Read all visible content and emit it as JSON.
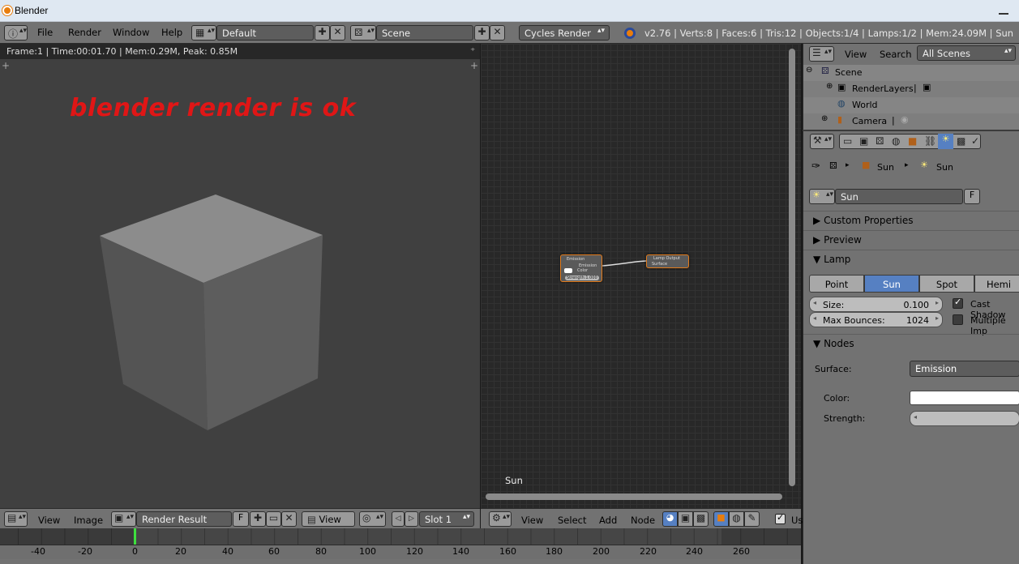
{
  "window": {
    "title": "Blender"
  },
  "header": {
    "menus": [
      "File",
      "Render",
      "Window",
      "Help"
    ],
    "layout": "Default",
    "scene": "Scene",
    "engine": "Cycles Render",
    "stats": "v2.76 | Verts:8 | Faces:6 | Tris:12 | Objects:1/4 | Lamps:1/2 | Mem:24.09M | Sun"
  },
  "viewport": {
    "info": "Frame:1 | Time:00:01.70 | Mem:0.29M, Peak: 0.85M",
    "overlay_text": "blender render is ok"
  },
  "image_editor_bar": {
    "view": "View",
    "image": "Image",
    "image_name": "Render Result",
    "fake_user": "F",
    "view_select": "View",
    "slot": "Slot 1"
  },
  "node_editor": {
    "label": "Sun",
    "emission_node": {
      "title": "Emission",
      "output": "Emission",
      "color_label": "Color",
      "strength": "Strength:1.000"
    },
    "output_node": {
      "title": "Lamp Output",
      "input": "Surface"
    },
    "bar": {
      "view": "View",
      "select": "Select",
      "add": "Add",
      "node": "Node",
      "use_nodes": "Us"
    }
  },
  "timeline": {
    "ticks": [
      "-40",
      "-20",
      "0",
      "20",
      "40",
      "60",
      "80",
      "100",
      "120",
      "140",
      "160",
      "180",
      "200",
      "220",
      "240",
      "260"
    ]
  },
  "outliner": {
    "view": "View",
    "search": "Search",
    "filter": "All Scenes",
    "items": [
      {
        "label": "Scene"
      },
      {
        "label": "RenderLayers"
      },
      {
        "label": "World"
      },
      {
        "label": "Camera"
      }
    ]
  },
  "properties": {
    "breadcrumb": [
      "Sun",
      "Sun"
    ],
    "datablock": "Sun",
    "fake_user": "F",
    "panels": {
      "custom_properties": "Custom Properties",
      "preview": "Preview",
      "lamp": "Lamp",
      "nodes": "Nodes"
    },
    "lamp_types": [
      "Point",
      "Sun",
      "Spot",
      "Hemi"
    ],
    "active_lamp_type": "Sun",
    "size_label": "Size:",
    "size_value": "0.100",
    "bounces_label": "Max Bounces:",
    "bounces_value": "1024",
    "cast_shadow": "Cast Shadow",
    "multiple_importance": "Multiple Imp",
    "surface_label": "Surface:",
    "surface_value": "Emission",
    "color_label": "Color:",
    "strength_label": "Strength:"
  },
  "colors": {
    "accent": "#5680c2",
    "node_border": "#e27b1c",
    "overlay_text": "#e01616",
    "frame_marker": "#3ee03e"
  }
}
